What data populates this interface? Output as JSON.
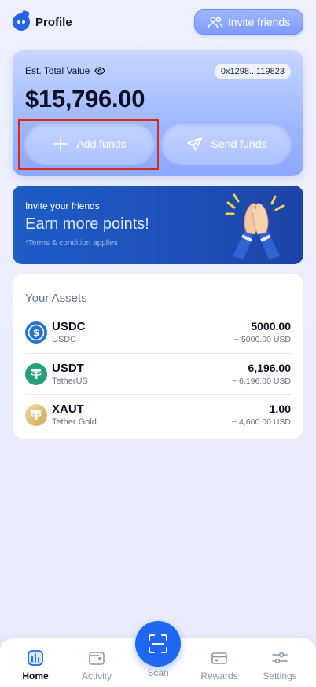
{
  "header": {
    "title": "Profile",
    "invite_label": "Invite friends"
  },
  "balance": {
    "label": "Est. Total Value",
    "address": "0x1298...119823",
    "total": "$15,796.00",
    "add_funds_label": "Add funds",
    "send_funds_label": "Send funds"
  },
  "banner": {
    "kicker": "Invite your friends",
    "title": "Earn more points!",
    "note": "*Terms & condition applies"
  },
  "assets": {
    "title": "Your Assets",
    "items": [
      {
        "symbol": "USDC",
        "name": "USDC",
        "amount": "5000.00",
        "usd": "~ 5000.00 USD",
        "icon": "usdc-coin-icon",
        "color": "#2775ca"
      },
      {
        "symbol": "USDT",
        "name": "TetherUS",
        "amount": "6,196.00",
        "usd": "~ 6,196.00 USD",
        "icon": "usdt-coin-icon",
        "color": "#26a17b"
      },
      {
        "symbol": "XAUT",
        "name": "Tether Gold",
        "amount": "1.00",
        "usd": "~ 4,600.00 USD",
        "icon": "xaut-coin-icon",
        "color": "#d4b06a"
      }
    ]
  },
  "nav": {
    "home": "Home",
    "activity": "Activity",
    "scan": "Scan",
    "rewards": "Rewards",
    "settings": "Settings",
    "active": "home"
  },
  "colors": {
    "accent": "#1f66f0",
    "banner": "#1e5cc7"
  }
}
